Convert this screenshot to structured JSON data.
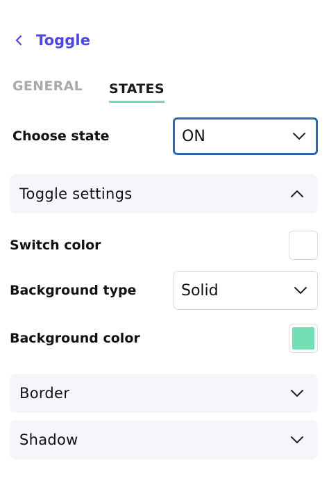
{
  "header": {
    "title": "Toggle",
    "back_icon": "chevron-left-icon"
  },
  "tabs": [
    {
      "label": "GENERAL",
      "active": false
    },
    {
      "label": "STATES",
      "active": true
    }
  ],
  "choose_state": {
    "label": "Choose state",
    "value": "ON"
  },
  "sections": {
    "toggle_settings": {
      "label": "Toggle settings",
      "expanded": true
    },
    "border": {
      "label": "Border",
      "expanded": false
    },
    "shadow": {
      "label": "Shadow",
      "expanded": false
    }
  },
  "toggle_settings": {
    "switch_color": {
      "label": "Switch color",
      "color": "#ffffff"
    },
    "background_type": {
      "label": "Background type",
      "value": "Solid"
    },
    "background_color": {
      "label": "Background color",
      "color": "#72e0b4"
    }
  },
  "colors": {
    "accent": "#4b47e0",
    "tab_underline": "#6fdbb4",
    "focus_border": "#2f66b3",
    "section_bg": "#f5f5fc"
  }
}
